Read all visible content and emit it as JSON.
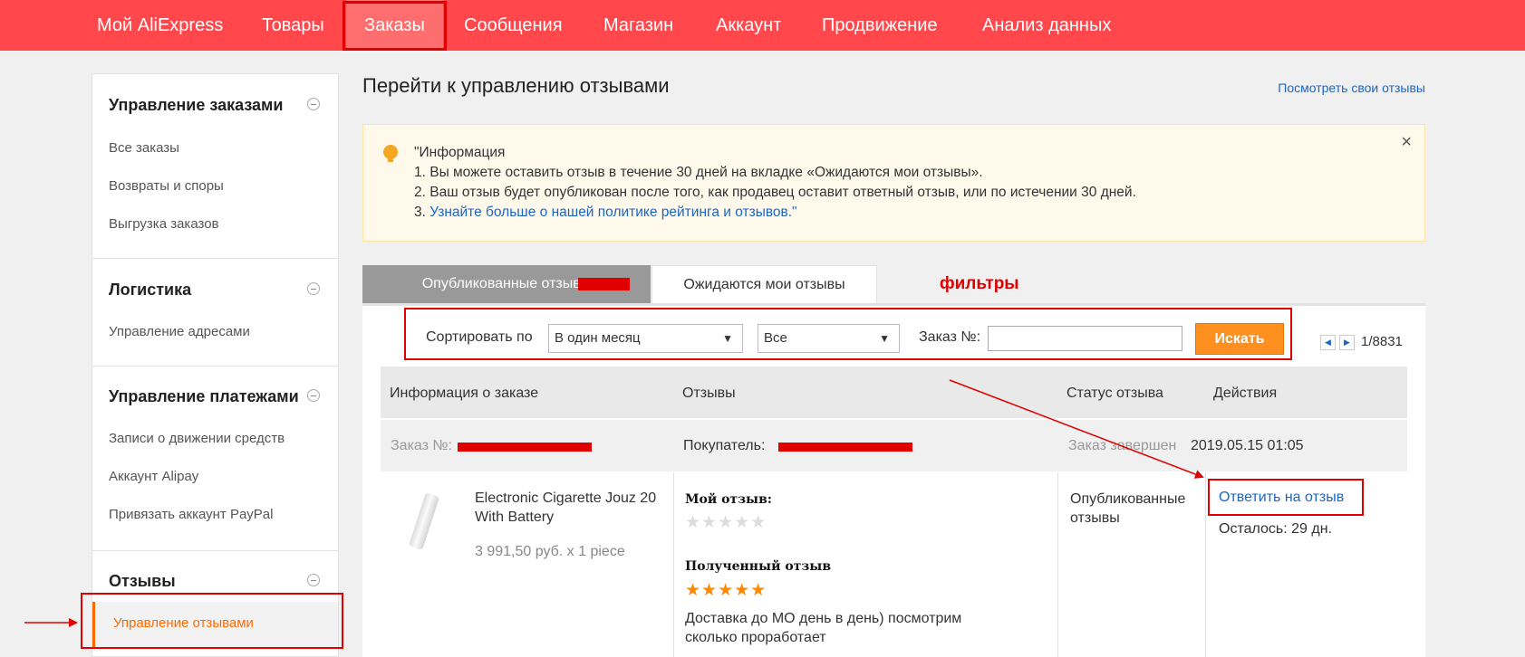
{
  "nav": {
    "items": [
      "Мой AliExpress",
      "Товары",
      "Заказы",
      "Сообщения",
      "Магазин",
      "Аккаунт",
      "Продвижение",
      "Анализ данных"
    ]
  },
  "sidebar": {
    "sections": [
      {
        "title": "Управление заказами",
        "items": [
          "Все заказы",
          "Возвраты и споры",
          "Выгрузка заказов"
        ]
      },
      {
        "title": "Логистика",
        "items": [
          "Управление адресами"
        ]
      },
      {
        "title": "Управление платежами",
        "items": [
          "Записи о движении средств",
          "Аккаунт Alipay",
          "Привязать аккаунт PayPal"
        ]
      },
      {
        "title": "Отзывы",
        "items": [
          "Управление отзывами"
        ]
      }
    ]
  },
  "main": {
    "title": "Перейти к управлению отзывами",
    "own_reviews_link": "Посмотреть свои отзывы",
    "info": {
      "heading": "\"Информация",
      "line1": "1. Вы можете оставить отзыв в течение 30 дней на вкладке «Ожидаются мои отзывы».",
      "line2": "2. Ваш отзыв будет опубликован после того, как продавец оставит ответный отзыв, или по истечении 30 дней.",
      "line3_prefix": "3. ",
      "line3_link": "Узнайте больше о нашей политике рейтинга и отзывов.\"",
      "close": "×"
    },
    "tabs": {
      "published": "Опубликованные отзывы",
      "pending": "Ожидаются мои отзывы"
    },
    "filters_label": "фильтры",
    "filter": {
      "sort_label": "Сортировать по",
      "period_value": "В один месяц",
      "status_value": "Все",
      "order_label": "Заказ №:",
      "order_value": "",
      "search_button": "Искать",
      "pager": "1/8831"
    },
    "table": {
      "headers": [
        "Информация о заказе",
        "Отзывы",
        "Статус отзыва",
        "Действия"
      ],
      "order_label": "Заказ №:",
      "buyer_label": "Покупатель:",
      "completed_label": "Заказ завершен",
      "completed_date": "2019.05.15 01:05",
      "product_name": "Electronic Cigarette Jouz 20 With Battery",
      "product_price": "3 991,50 руб. x 1 piece",
      "my_review_title": "Мой отзыв:",
      "my_review_stars": 0,
      "received_review_title": "Полученный отзыв",
      "received_review_stars": 5,
      "received_review_text": "Доставка до МО день в день) посмотрим сколько проработает",
      "status": "Опубликованные отзывы",
      "reply_action": "Ответить на отзыв",
      "remaining": "Осталось: 29 дн."
    }
  },
  "colors": {
    "nav_bg": "#ff474c",
    "accent_orange": "#ff6a00",
    "annotation_red": "#e00000",
    "link_blue": "#1a66c8",
    "search_button": "#ff8f1f",
    "star_filled": "#ff8a00"
  }
}
